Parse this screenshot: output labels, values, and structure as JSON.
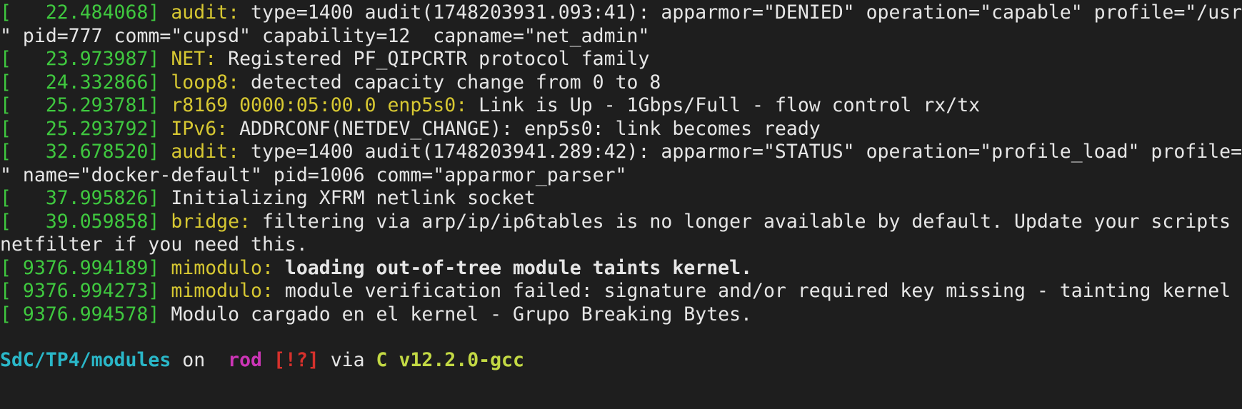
{
  "colors": {
    "background": "#1e1e1e",
    "text": "#e6e6e6",
    "timestamp": "#3fc83f",
    "facility": "#d7c832",
    "path": "#2ab7c8",
    "branch": "#cc35b6",
    "git_status": "#d6312c",
    "toolchain": "#c3d944"
  },
  "log": [
    {
      "bracket": "[",
      "ts": "   22.484068]",
      "fac": " audit:",
      "msg": " type=1400 audit(1748203931.093:41): apparmor=\"DENIED\" operation=\"capable\" profile=\"/usr"
    },
    {
      "cont": "\" pid=777 comm=\"cupsd\" capability=12  capname=\"net_admin\""
    },
    {
      "bracket": "[",
      "ts": "   23.973987]",
      "fac": " NET:",
      "msg": " Registered PF_QIPCRTR protocol family"
    },
    {
      "bracket": "[",
      "ts": "   24.332866]",
      "fac": " loop8:",
      "msg": " detected capacity change from 0 to 8"
    },
    {
      "bracket": "[",
      "ts": "   25.293781]",
      "fac": " r8169 0000:05:00.0 enp5s0:",
      "msg": " Link is Up - 1Gbps/Full - flow control rx/tx"
    },
    {
      "bracket": "[",
      "ts": "   25.293792]",
      "fac": " IPv6:",
      "msg": " ADDRCONF(NETDEV_CHANGE): enp5s0: link becomes ready"
    },
    {
      "bracket": "[",
      "ts": "   32.678520]",
      "fac": " audit:",
      "msg": " type=1400 audit(1748203941.289:42): apparmor=\"STATUS\" operation=\"profile_load\" profile="
    },
    {
      "cont": "\" name=\"docker-default\" pid=1006 comm=\"apparmor_parser\""
    },
    {
      "bracket": "[",
      "ts": "   37.995826]",
      "fac": "",
      "msg": " Initializing XFRM netlink socket"
    },
    {
      "bracket": "[",
      "ts": "   39.059858]",
      "fac": " bridge:",
      "msg": " filtering via arp/ip/ip6tables is no longer available by default. Update your scripts"
    },
    {
      "cont": "netfilter if you need this."
    },
    {
      "bracket": "[",
      "ts": " 9376.994189]",
      "fac": " mimodulo:",
      "msg": " loading out-of-tree module taints kernel.",
      "bold": true
    },
    {
      "bracket": "[",
      "ts": " 9376.994273]",
      "fac": " mimodulo:",
      "msg": " module verification failed: signature and/or required key missing - tainting kernel"
    },
    {
      "bracket": "[",
      "ts": " 9376.994578]",
      "fac": "",
      "msg": " Modulo cargado en el kernel - Grupo Breaking Bytes."
    }
  ],
  "prompt": {
    "path": "SdC/TP4/modules",
    "on": " on ",
    "branch_icon": "",
    "branch": " rod",
    "status": " [!?]",
    "via": " via ",
    "lang_icon": "C",
    "version": " v12.2.0-gcc"
  }
}
